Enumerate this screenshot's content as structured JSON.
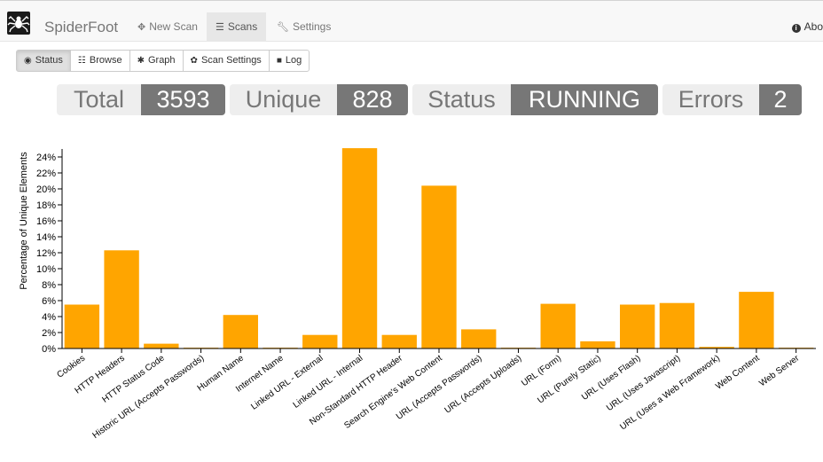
{
  "nav": {
    "brand": "SpiderFoot",
    "new_scan": "New Scan",
    "scans": "Scans",
    "settings": "Settings",
    "about": "Abo"
  },
  "tabs": {
    "status": "Status",
    "browse": "Browse",
    "graph": "Graph",
    "scan_settings": "Scan Settings",
    "log": "Log"
  },
  "stats": {
    "total_label": "Total",
    "total_value": "3593",
    "unique_label": "Unique",
    "unique_value": "828",
    "status_label": "Status",
    "status_value": "RUNNING",
    "errors_label": "Errors",
    "errors_value": "2"
  },
  "colors": {
    "bar": "#ffa500",
    "stat_label_bg": "#eeeeee",
    "stat_value_bg": "#777777"
  },
  "chart_data": {
    "type": "bar",
    "ylabel": "Percentage of Unique Elements",
    "ylim": [
      0,
      25
    ],
    "yticks": [
      "0%",
      "2%",
      "4%",
      "6%",
      "8%",
      "10%",
      "12%",
      "14%",
      "16%",
      "18%",
      "20%",
      "22%",
      "24%"
    ],
    "categories": [
      "Cookies",
      "HTTP Headers",
      "HTTP Status Code",
      "Historic URL (Accepts Passwords)",
      "Human Name",
      "Internet Name",
      "Linked URL - External",
      "Linked URL - Internal",
      "Non-Standard HTTP Header",
      "Search Engine's Web Content",
      "URL (Accepts Passwords)",
      "URL (Accepts Uploads)",
      "URL (Form)",
      "URL (Purely Static)",
      "URL (Uses Flash)",
      "URL (Uses Javascript)",
      "URL (Uses a Web Framework)",
      "Web Content",
      "Web Server"
    ],
    "values": [
      5.5,
      12.3,
      0.6,
      0.1,
      4.2,
      0.1,
      1.7,
      25.1,
      1.7,
      20.4,
      2.4,
      0.1,
      5.6,
      0.9,
      5.5,
      5.7,
      0.2,
      7.1,
      0.1
    ],
    "grid": false
  }
}
